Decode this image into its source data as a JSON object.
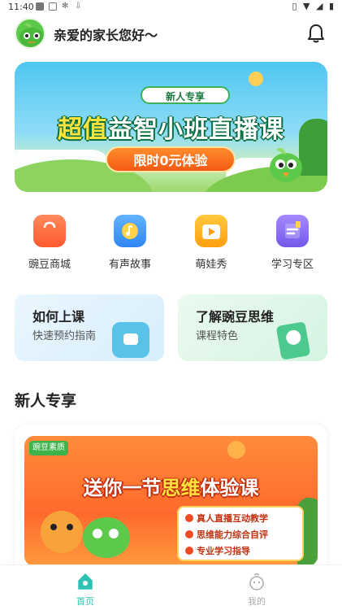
{
  "status_bar": {
    "time": "11:40"
  },
  "header": {
    "greeting": "亲爱的家长您好～"
  },
  "banner": {
    "tag": "新人专享",
    "title_highlight": "超值",
    "title_rest": "益智小班直播课",
    "button": "限时0元体验"
  },
  "quick_menu": [
    {
      "label": "豌豆商城",
      "icon": "shopping-bag-icon",
      "color": "#ff6a3d"
    },
    {
      "label": "有声故事",
      "icon": "music-note-icon",
      "color": "#3f9bff"
    },
    {
      "label": "萌娃秀",
      "icon": "video-play-icon",
      "color": "#ffb21c"
    },
    {
      "label": "学习专区",
      "icon": "book-icon",
      "color": "#8a6cf2"
    }
  ],
  "cards": [
    {
      "title": "如何上课",
      "subtitle": "快速预约指南"
    },
    {
      "title": "了解豌豆思维",
      "subtitle": "课程特色"
    }
  ],
  "section": {
    "title": "新人专享"
  },
  "promo": {
    "logo": "豌豆素质",
    "title_a": "送你一节",
    "title_highlight": "思维",
    "title_b": "体验课",
    "points": [
      "真人直播互动教学",
      "思维能力综合自评",
      "专业学习指导"
    ]
  },
  "tabs": [
    {
      "label": "首页",
      "active": true,
      "color": "#2ec2b3"
    },
    {
      "label": "我的",
      "active": false,
      "color": "#aaaaaa"
    }
  ]
}
